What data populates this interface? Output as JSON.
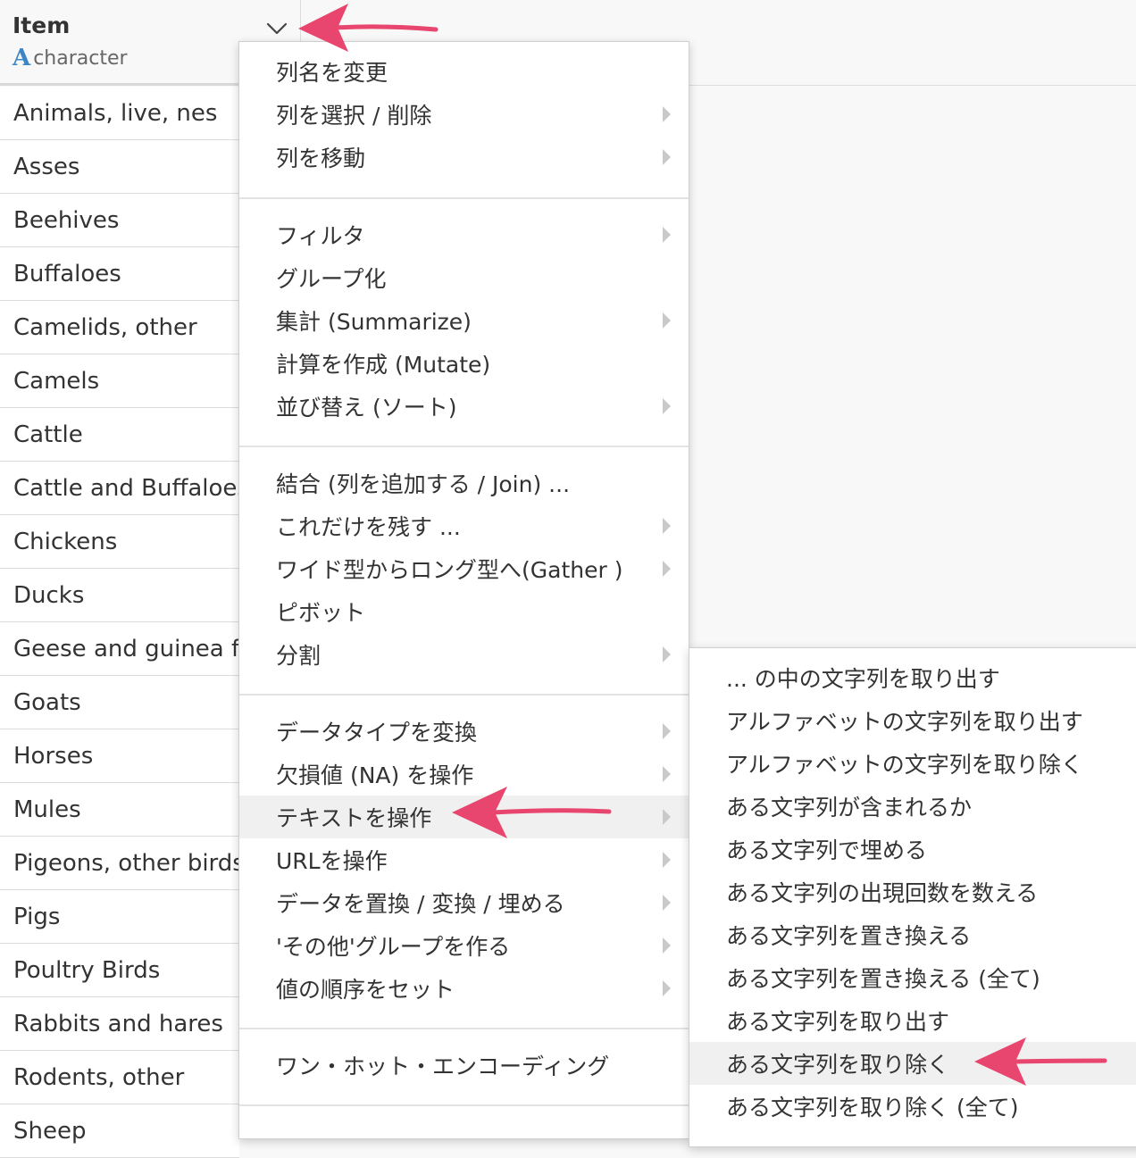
{
  "column": {
    "name": "Item",
    "type_icon_letter": "A",
    "type_label": "character"
  },
  "rows": [
    "Animals, live, nes",
    "Asses",
    "Beehives",
    "Buffaloes",
    "Camelids, other",
    "Camels",
    "Cattle",
    "Cattle and Buffaloes",
    "Chickens",
    "Ducks",
    "Geese and guinea fowls",
    "Goats",
    "Horses",
    "Mules",
    "Pigeons, other birds",
    "Pigs",
    "Poultry Birds",
    "Rabbits and hares",
    "Rodents, other",
    "Sheep"
  ],
  "menu": {
    "items": [
      {
        "label": "列名を変更",
        "submenu": false
      },
      {
        "label": "列を選択 / 削除",
        "submenu": true
      },
      {
        "label": "列を移動",
        "submenu": true
      },
      {
        "label": "フィルタ",
        "submenu": true
      },
      {
        "label": "グループ化",
        "submenu": false
      },
      {
        "label": "集計 (Summarize)",
        "submenu": true
      },
      {
        "label": "計算を作成 (Mutate)",
        "submenu": false
      },
      {
        "label": "並び替え (ソート)",
        "submenu": true
      },
      {
        "label": "結合 (列を追加する / Join) ...",
        "submenu": false
      },
      {
        "label": "これだけを残す ...",
        "submenu": true
      },
      {
        "label": "ワイド型からロング型へ(Gather )",
        "submenu": true
      },
      {
        "label": "ピボット",
        "submenu": false
      },
      {
        "label": "分割",
        "submenu": true
      },
      {
        "label": "データタイプを変換",
        "submenu": true
      },
      {
        "label": "欠損値 (NA) を操作",
        "submenu": true
      },
      {
        "label": "テキストを操作",
        "submenu": true,
        "highlighted": true
      },
      {
        "label": "URLを操作",
        "submenu": true
      },
      {
        "label": "データを置換 / 変換 / 埋める",
        "submenu": true
      },
      {
        "label": "'その他'グループを作る",
        "submenu": true
      },
      {
        "label": "値の順序をセット",
        "submenu": true
      },
      {
        "label": "ワン・ホット・エンコーディング",
        "submenu": false
      }
    ]
  },
  "submenu": {
    "items": [
      {
        "label": "... の中の文字列を取り出す"
      },
      {
        "label": "アルファベットの文字列を取り出す"
      },
      {
        "label": "アルファベットの文字列を取り除く"
      },
      {
        "label": "ある文字列が含まれるか"
      },
      {
        "label": "ある文字列で埋める"
      },
      {
        "label": "ある文字列の出現回数を数える"
      },
      {
        "label": "ある文字列を置き換える"
      },
      {
        "label": "ある文字列を置き換える (全て)"
      },
      {
        "label": "ある文字列を取り出す"
      },
      {
        "label": "ある文字列を取り除く",
        "highlighted": true
      },
      {
        "label": "ある文字列を取り除く (全て)"
      }
    ]
  },
  "annotation_color": "#e8466e"
}
